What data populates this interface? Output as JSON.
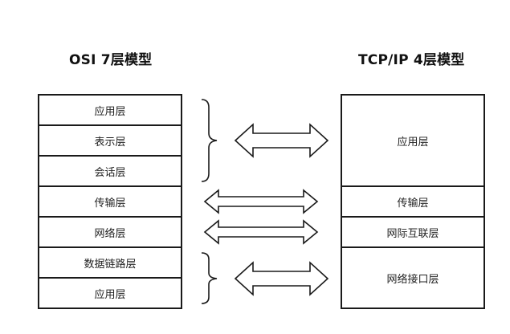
{
  "titles": {
    "left": "OSI 7层模型",
    "right": "TCP/IP 4层模型"
  },
  "osi_layers": [
    "应用层",
    "表示层",
    "会话层",
    "传输层",
    "网络层",
    "数据链路层",
    "应用层"
  ],
  "tcpip_layers": [
    "应用层",
    "传输层",
    "网际互联层",
    "网络接口层"
  ]
}
